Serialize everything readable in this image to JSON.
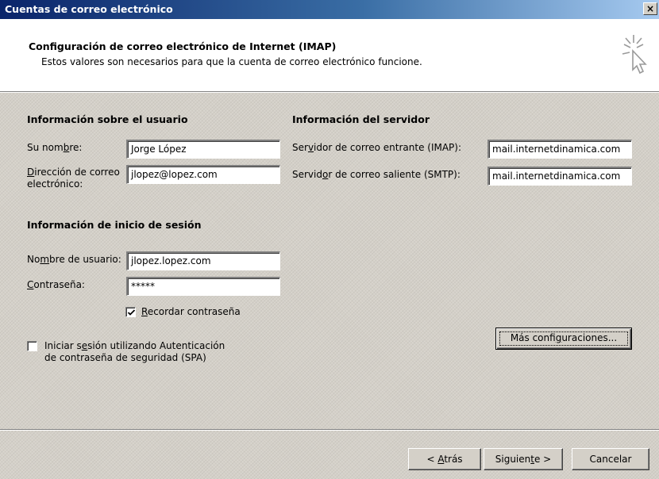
{
  "window": {
    "title": "Cuentas de correo electrónico",
    "close_glyph": "×"
  },
  "header": {
    "title": "Configuración de correo electrónico de Internet (IMAP)",
    "subtitle": "Estos valores son necesarios para que la cuenta de correo electrónico funcione.",
    "icon": "wizard-cursor-icon"
  },
  "user_info": {
    "heading": "Información sobre el usuario",
    "name_label_pre": "Su nom",
    "name_label_key": "b",
    "name_label_post": "re:",
    "name_value": "Jorge López",
    "email_label_key": "D",
    "email_label_line1_post": "irección de correo",
    "email_label_line2": "electrónico:",
    "email_value": "jlopez@lopez.com"
  },
  "server_info": {
    "heading": "Información del servidor",
    "incoming_label_pre": "Ser",
    "incoming_label_key": "v",
    "incoming_label_post": "idor de correo entrante (IMAP):",
    "incoming_value": "mail.internetdinamica.com",
    "outgoing_label_pre": "Servid",
    "outgoing_label_key": "o",
    "outgoing_label_post": "r de correo saliente (SMTP):",
    "outgoing_value": "mail.internetdinamica.com"
  },
  "login_info": {
    "heading": "Información de inicio de sesión",
    "username_label_pre": "No",
    "username_label_key": "m",
    "username_label_post": "bre de usuario:",
    "username_value": "jlopez.lopez.com",
    "password_label_key": "C",
    "password_label_post": "ontraseña:",
    "password_value": "*****",
    "remember_label_key": "R",
    "remember_label_post": "ecordar contraseña",
    "remember_checked": true,
    "spa_label_line1_pre": "Iniciar s",
    "spa_label_line1_key": "e",
    "spa_label_line1_post": "sión utilizando Autenticación",
    "spa_label_line2": "de contraseña de seguridad (SPA)",
    "spa_checked": false
  },
  "more_settings": {
    "label_pre": "Más confi",
    "label_key": "g",
    "label_post": "uraciones..."
  },
  "footer": {
    "back_pre": "< ",
    "back_key": "A",
    "back_post": "trás",
    "next_pre": "Siguien",
    "next_key": "t",
    "next_post": "e >",
    "cancel": "Cancelar"
  },
  "colors": {
    "title_bar_start": "#0a246a",
    "title_bar_end": "#a6caf0",
    "dialog_face": "#d4d0c8"
  }
}
